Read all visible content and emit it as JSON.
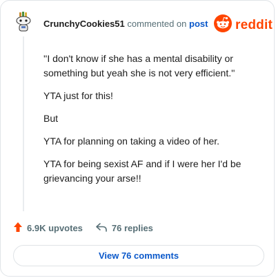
{
  "header": {
    "username": "CrunchyCookies51",
    "action_text": "commented on",
    "target": "post",
    "brand": "reddit"
  },
  "comment": {
    "paragraphs": [
      "''I don't know if she has a mental disability or something but yeah she is not very efficient.''",
      "YTA just for this!",
      "But",
      "YTA for planning on taking a video of her.",
      "YTA for being sexist AF and if I were her I'd be grievancing your arse!!"
    ]
  },
  "stats": {
    "upvotes": "6.9K upvotes",
    "replies": "76 replies"
  },
  "footer": {
    "view_comments": "View 76 comments"
  },
  "icons": {
    "avatar": "snoo-avatar-icon",
    "brand": "reddit-logo-icon",
    "upvote": "upvote-arrow-icon",
    "reply": "reply-arrow-icon"
  },
  "colors": {
    "brand": "#ff4500",
    "link": "#0a58ca",
    "muted": "#576f76",
    "text": "#1c1c1c"
  }
}
